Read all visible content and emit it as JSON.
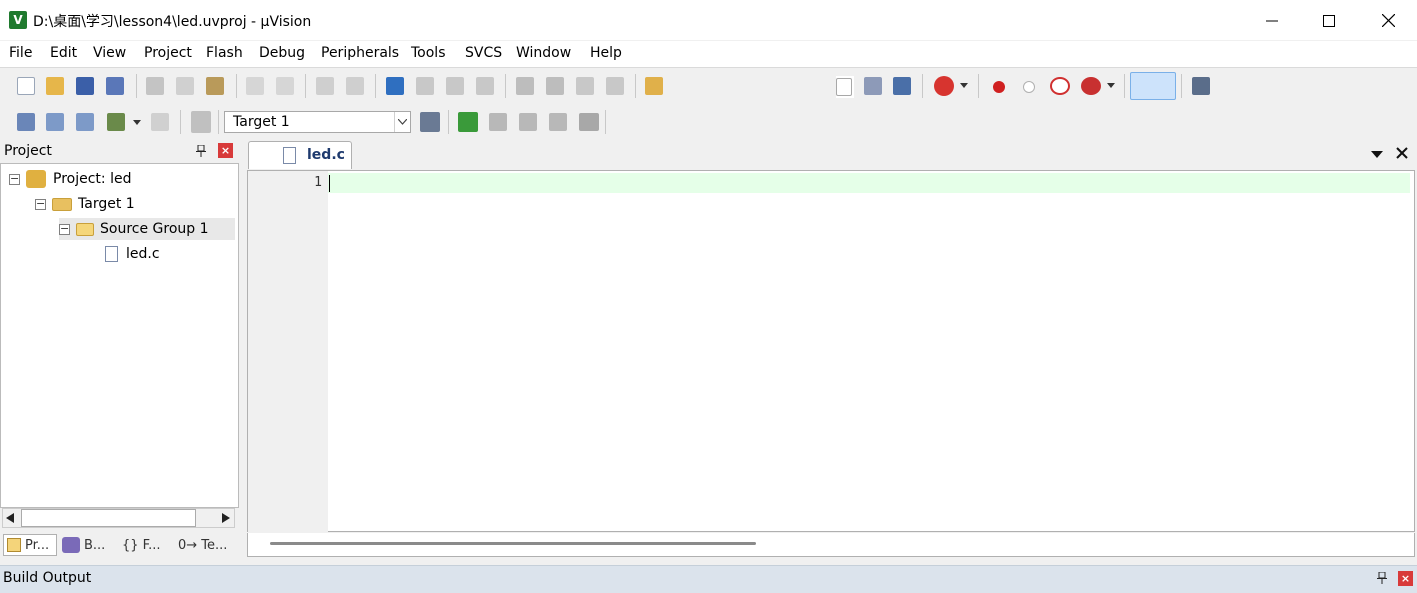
{
  "window": {
    "title": "D:\\桌面\\学习\\lesson4\\led.uvproj - µVision",
    "app_icon_glyph": "V"
  },
  "menu": [
    "File",
    "Edit",
    "View",
    "Project",
    "Flash",
    "Debug",
    "Peripherals",
    "Tools",
    "SVCS",
    "Window",
    "Help"
  ],
  "toolbar2": {
    "target_select": "Target 1"
  },
  "project_panel": {
    "title": "Project",
    "tree": {
      "project": "Project: led",
      "target": "Target 1",
      "group": "Source Group 1",
      "file": "led.c"
    },
    "bottom_tabs": [
      "Pr...",
      "B...",
      "{} F...",
      "0→ Te..."
    ]
  },
  "editor": {
    "tab_label": "led.c",
    "line_numbers": [
      "1"
    ]
  },
  "build_output": {
    "title": "Build Output"
  },
  "colors": {
    "current_line": "#e5ffe8",
    "close_red": "#d83a3a",
    "build_bar": "#dbe3ec"
  },
  "icons": {
    "toolbar1": [
      "new-file-icon",
      "open-icon",
      "save-icon",
      "save-all-icon",
      "cut-icon",
      "copy-icon",
      "paste-icon",
      "undo-icon",
      "redo-icon",
      "nav-back-icon",
      "nav-forward-icon",
      "bookmark-icon",
      "prev-bookmark-icon",
      "next-bookmark-icon",
      "clear-bookmarks-icon",
      "indent-icon",
      "unindent-icon",
      "comment-icon",
      "uncomment-icon",
      "find-in-files-icon",
      "find-icon",
      "incremental-find-icon",
      "debug-session-icon",
      "breakpoint-icon",
      "disable-breakpoint-icon",
      "disable-all-breakpoints-icon",
      "kill-breakpoints-icon",
      "window-layout-icon",
      "configure-icon"
    ],
    "toolbar2": [
      "translate-icon",
      "build-icon",
      "rebuild-icon",
      "batch-build-icon",
      "stop-build-icon",
      "download-icon",
      "target-options-icon",
      "manage-components-icon",
      "select-packs-icon",
      "pack-installer-icon",
      "manage-run-time-icon",
      "settings-icon"
    ]
  }
}
